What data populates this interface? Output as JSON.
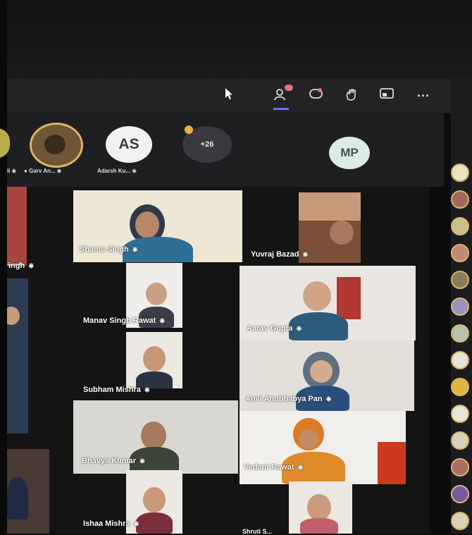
{
  "toolbar": {
    "icons": [
      "cursor-icon",
      "people-icon",
      "chat-icon",
      "hand-icon",
      "share-icon",
      "more-icon"
    ],
    "more_label": "···"
  },
  "strip": {
    "participants": [
      {
        "label": "Garv An..."
      },
      {
        "label": "Adarsh Ku...",
        "initials": "AS"
      }
    ],
    "overflow": "+26",
    "presenter_initials": "MP"
  },
  "tiles": [
    {
      "name": "ingh"
    },
    {
      "name": "Shama Singh"
    },
    {
      "name": "Yuvraj Bazad"
    },
    {
      "name": "Manav Singh Rawat"
    },
    {
      "name": "Aarav Gupta"
    },
    {
      "name": "Subham Mishra"
    },
    {
      "name": "Anvi Anubhabya Pan"
    },
    {
      "name": "Bhavya Kumar"
    },
    {
      "name": "Vedant Rawat"
    },
    {
      "name": "Ishaa Mishra"
    },
    {
      "name": "Shruti S..."
    }
  ],
  "colors": {
    "ring": "#d8b764",
    "toolbar": "#232326",
    "accent": "#6b6ff0"
  }
}
